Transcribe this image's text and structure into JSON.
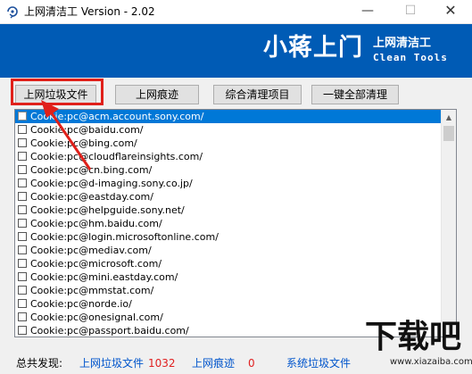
{
  "window": {
    "title": "上网清洁工 Version - 2.02",
    "min_glyph": "—",
    "max_glyph": "☐",
    "close_glyph": "✕"
  },
  "banner": {
    "main": "小蒋上门",
    "sub_cn": "上网清洁工",
    "sub_en": "Clean Tools",
    "bg_color": "#005bb5"
  },
  "toolbar": {
    "btn_internet_junk": "上网垃圾文件",
    "btn_internet_traces": "上网痕迹",
    "btn_combined": "综合清理项目",
    "btn_one_click": "一键全部清理"
  },
  "list": {
    "selected_index": 0,
    "items": [
      "Cookie:pc@acm.account.sony.com/",
      "Cookie:pc@baidu.com/",
      "Cookie:pc@bing.com/",
      "Cookie:pc@cloudflareinsights.com/",
      "Cookie:pc@cn.bing.com/",
      "Cookie:pc@d-imaging.sony.co.jp/",
      "Cookie:pc@eastday.com/",
      "Cookie:pc@helpguide.sony.net/",
      "Cookie:pc@hm.baidu.com/",
      "Cookie:pc@login.microsoftonline.com/",
      "Cookie:pc@mediav.com/",
      "Cookie:pc@microsoft.com/",
      "Cookie:pc@mini.eastday.com/",
      "Cookie:pc@mmstat.com/",
      "Cookie:pc@norde.io/",
      "Cookie:pc@onesignal.com/",
      "Cookie:pc@passport.baidu.com/"
    ]
  },
  "status": {
    "total_label": "总共发现:",
    "junk_label": "上网垃圾文件",
    "junk_count": "1032",
    "traces_label": "上网痕迹",
    "traces_count": "0",
    "system_label": "系统垃圾文件"
  },
  "watermark": {
    "text": "下载吧",
    "url": "www.xiazaiba.com"
  },
  "colors": {
    "highlight": "#e0201a",
    "selection": "#0078d7",
    "status_blue": "#0055cc",
    "status_red": "#e02020"
  }
}
